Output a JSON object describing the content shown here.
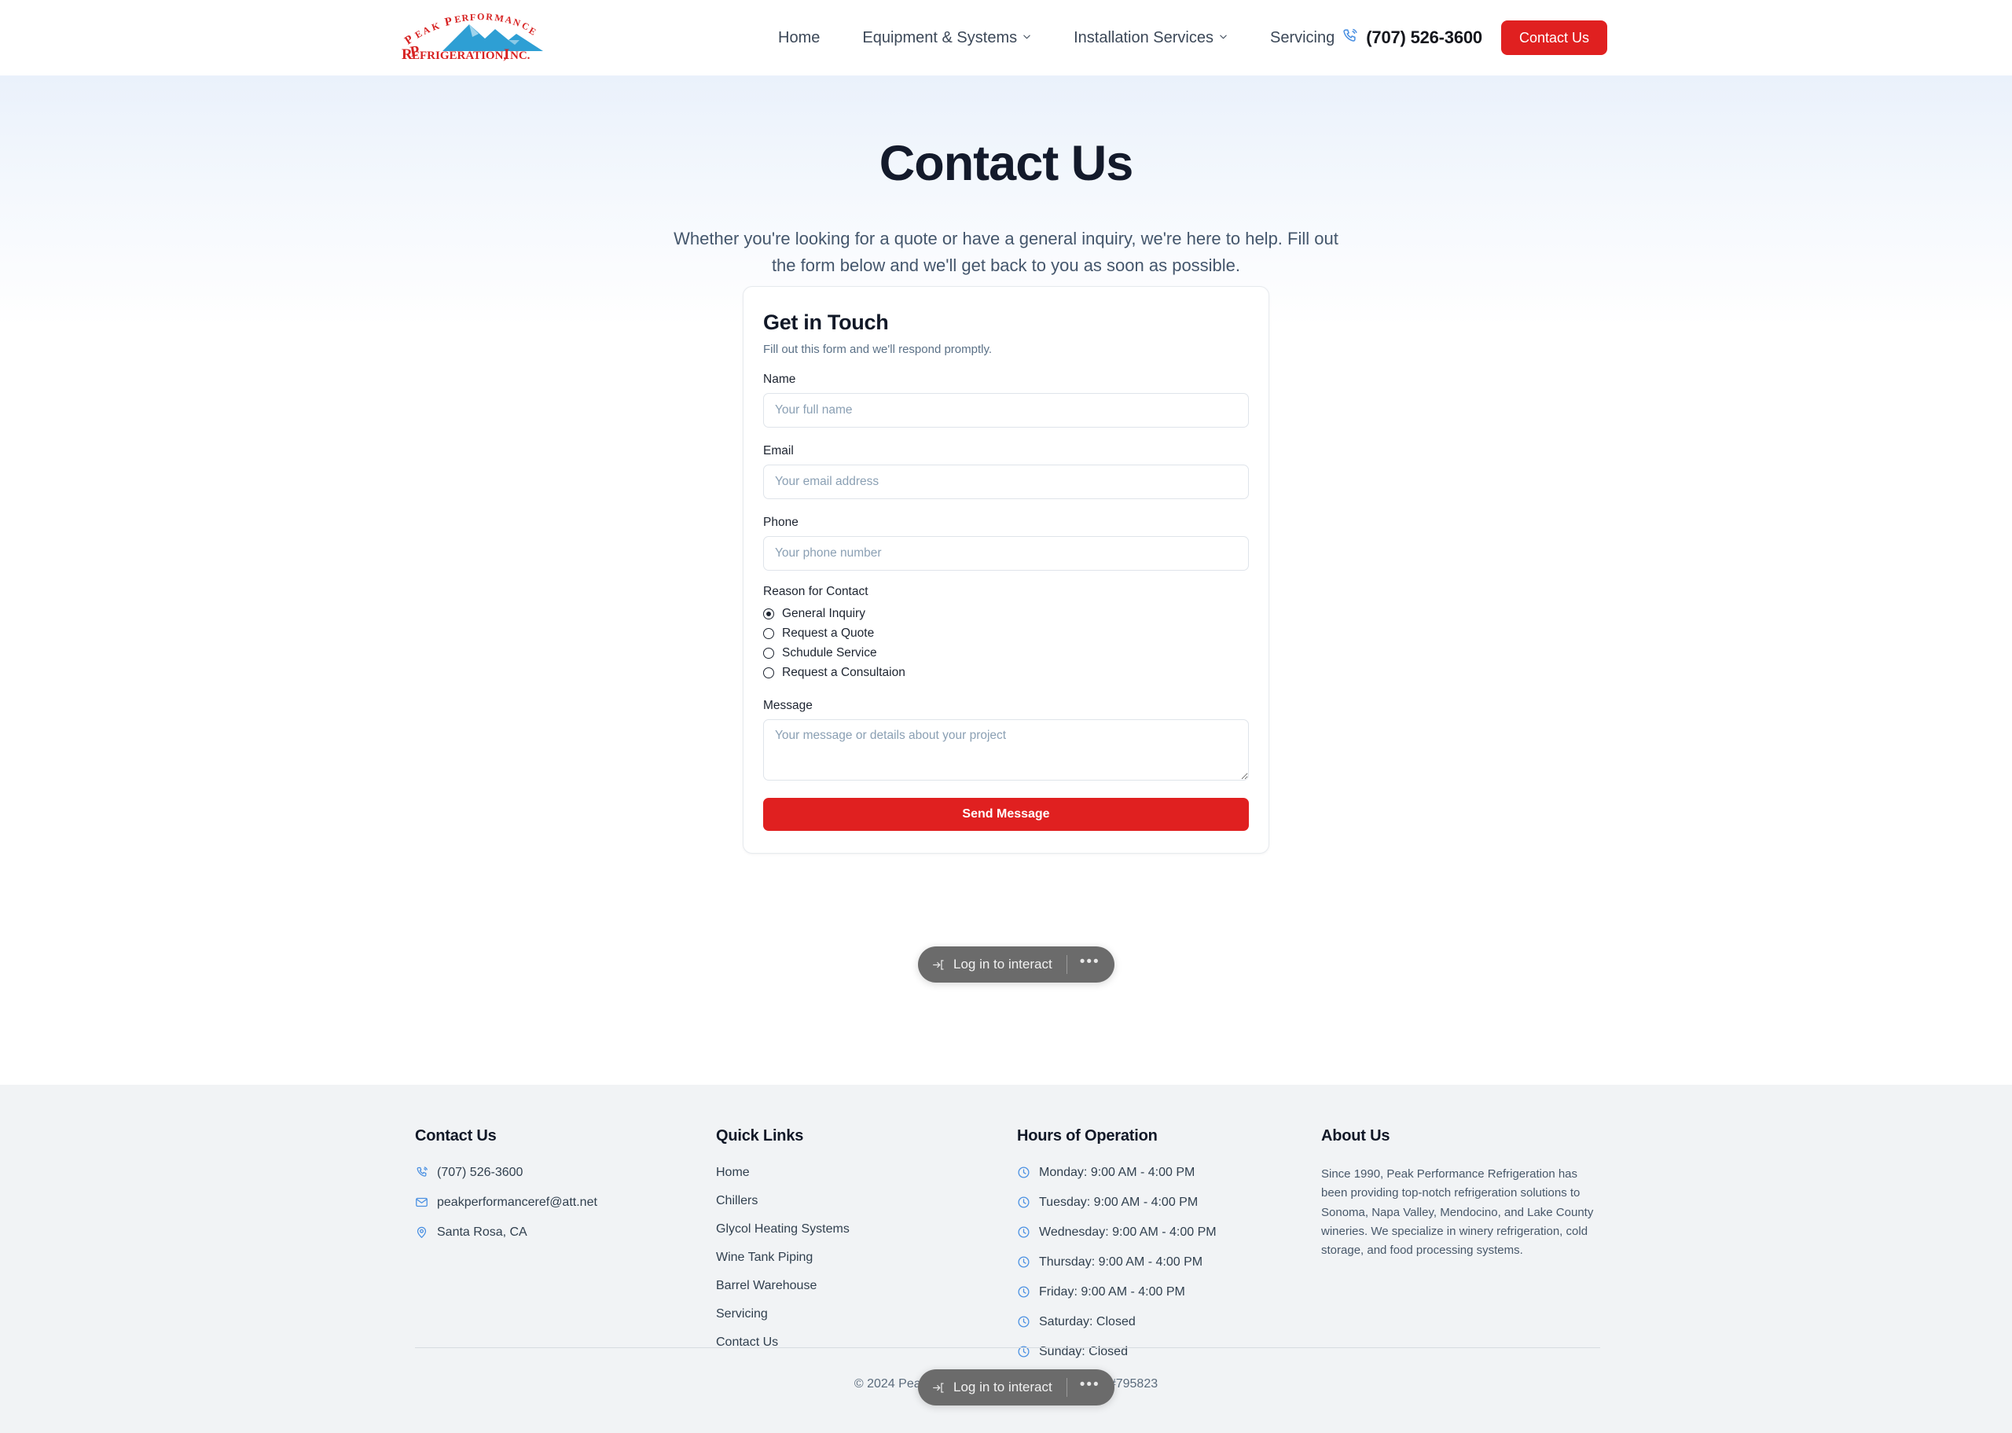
{
  "header": {
    "logo_line1": "Peak Performance",
    "logo_line2": "Refrigeration, Inc.",
    "nav": [
      {
        "label": "Home",
        "has_caret": false
      },
      {
        "label": "Equipment & Systems",
        "has_caret": true
      },
      {
        "label": "Installation Services",
        "has_caret": true
      },
      {
        "label": "Servicing",
        "has_caret": false
      }
    ],
    "phone": "(707) 526-3600",
    "phone_icon": "phone-ring-icon",
    "contact_button": "Contact Us"
  },
  "hero": {
    "title": "Contact Us",
    "subtitle": "Whether you're looking for a quote or have a general inquiry, we're here to help. Fill out the form below and we'll get back to you as soon as possible."
  },
  "form": {
    "title": "Get in Touch",
    "subtitle": "Fill out this form and we'll respond promptly.",
    "name_label": "Name",
    "name_placeholder": "Your full name",
    "name_value": "",
    "email_label": "Email",
    "email_placeholder": "Your email address",
    "email_value": "",
    "phone_label": "Phone",
    "phone_placeholder": "Your phone number",
    "phone_value": "",
    "reason_label": "Reason for Contact",
    "reasons": [
      {
        "label": "General Inquiry",
        "selected": true
      },
      {
        "label": "Request a Quote",
        "selected": false
      },
      {
        "label": "Schudule Service",
        "selected": false
      },
      {
        "label": "Request a Consultaion",
        "selected": false
      }
    ],
    "message_label": "Message",
    "message_placeholder": "Your message or details about your project",
    "message_value": "",
    "submit_label": "Send Message"
  },
  "overlay": {
    "login_label": "Log in to interact",
    "login_icon": "log-in-arrow-icon",
    "more_label": "•••"
  },
  "footer": {
    "contact": {
      "heading": "Contact Us",
      "items": [
        {
          "icon": "phone-ring-icon",
          "text": "(707) 526-3600"
        },
        {
          "icon": "mail-icon",
          "text": "peakperformanceref@att.net"
        },
        {
          "icon": "map-pin-icon",
          "text": "Santa Rosa, CA"
        }
      ]
    },
    "quick_links": {
      "heading": "Quick Links",
      "items": [
        "Home",
        "Chillers",
        "Glycol Heating Systems",
        "Wine Tank Piping",
        "Barrel Warehouse",
        "Servicing",
        "Contact Us"
      ]
    },
    "hours": {
      "heading": "Hours of Operation",
      "icon": "clock-icon",
      "items": [
        "Monday: 9:00 AM - 4:00 PM",
        "Tuesday: 9:00 AM - 4:00 PM",
        "Wednesday: 9:00 AM - 4:00 PM",
        "Thursday: 9:00 AM - 4:00 PM",
        "Friday: 9:00 AM - 4:00 PM",
        "Saturday: Closed",
        "Sunday: Closed"
      ]
    },
    "about": {
      "heading": "About Us",
      "text": "Since 1990, Peak Performance Refrigeration has been providing top-notch refrigeration solutions to Sonoma, Napa Valley, Mendocino, and Lake County wineries. We specialize in winery refrigeration, cold storage, and food processing systems."
    },
    "copyright": "© 2024 Peak Performance Refrigeration, Inc. #795823"
  },
  "colors": {
    "brand_red": "#e02020",
    "accent_blue": "#4a90e2",
    "footer_bg": "#f1f3f5",
    "text_dark": "#111827"
  }
}
